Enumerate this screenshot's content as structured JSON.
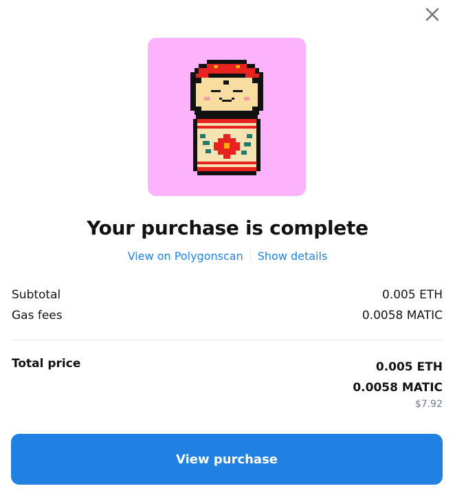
{
  "dialog": {
    "close_icon": "close-icon",
    "title": "Your purchase is complete",
    "links": {
      "polygonscan": "View on Polygonscan",
      "details": "Show details"
    },
    "subtotal": {
      "label": "Subtotal",
      "value": "0.005 ETH"
    },
    "gas_fees": {
      "label": "Gas fees",
      "value": "0.0058 MATIC"
    },
    "total": {
      "label": "Total price",
      "eth": "0.005 ETH",
      "matic": "0.0058 MATIC",
      "usd": "$7.92"
    },
    "view_purchase_button": "View purchase"
  },
  "colors": {
    "accent": "#2081e2",
    "nft_background": "#fdb3fb",
    "muted_text": "#707a83",
    "divider": "#e5e8eb"
  }
}
